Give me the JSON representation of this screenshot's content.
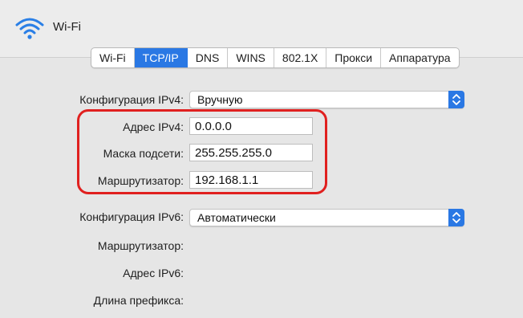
{
  "window": {
    "title": "Wi-Fi"
  },
  "tabs": [
    {
      "label": "Wi-Fi",
      "active": false
    },
    {
      "label": "TCP/IP",
      "active": true
    },
    {
      "label": "DNS",
      "active": false
    },
    {
      "label": "WINS",
      "active": false
    },
    {
      "label": "802.1X",
      "active": false
    },
    {
      "label": "Прокси",
      "active": false
    },
    {
      "label": "Аппаратура",
      "active": false
    }
  ],
  "ipv4": {
    "config_label": "Конфигурация IPv4:",
    "config_value": "Вручную",
    "address_label": "Адрес IPv4:",
    "address_value": "0.0.0.0",
    "mask_label": "Маска подсети:",
    "mask_value": "255.255.255.0",
    "router_label": "Маршрутизатор:",
    "router_value": "192.168.1.1"
  },
  "ipv6": {
    "config_label": "Конфигурация IPv6:",
    "config_value": "Автоматически",
    "router_label": "Маршрутизатор:",
    "address_label": "Адрес IPv6:",
    "prefix_label": "Длина префикса:"
  },
  "colors": {
    "accent": "#2a78e4",
    "highlight": "#e0201f",
    "panel": "#e6e6e6",
    "background": "#ececec"
  }
}
